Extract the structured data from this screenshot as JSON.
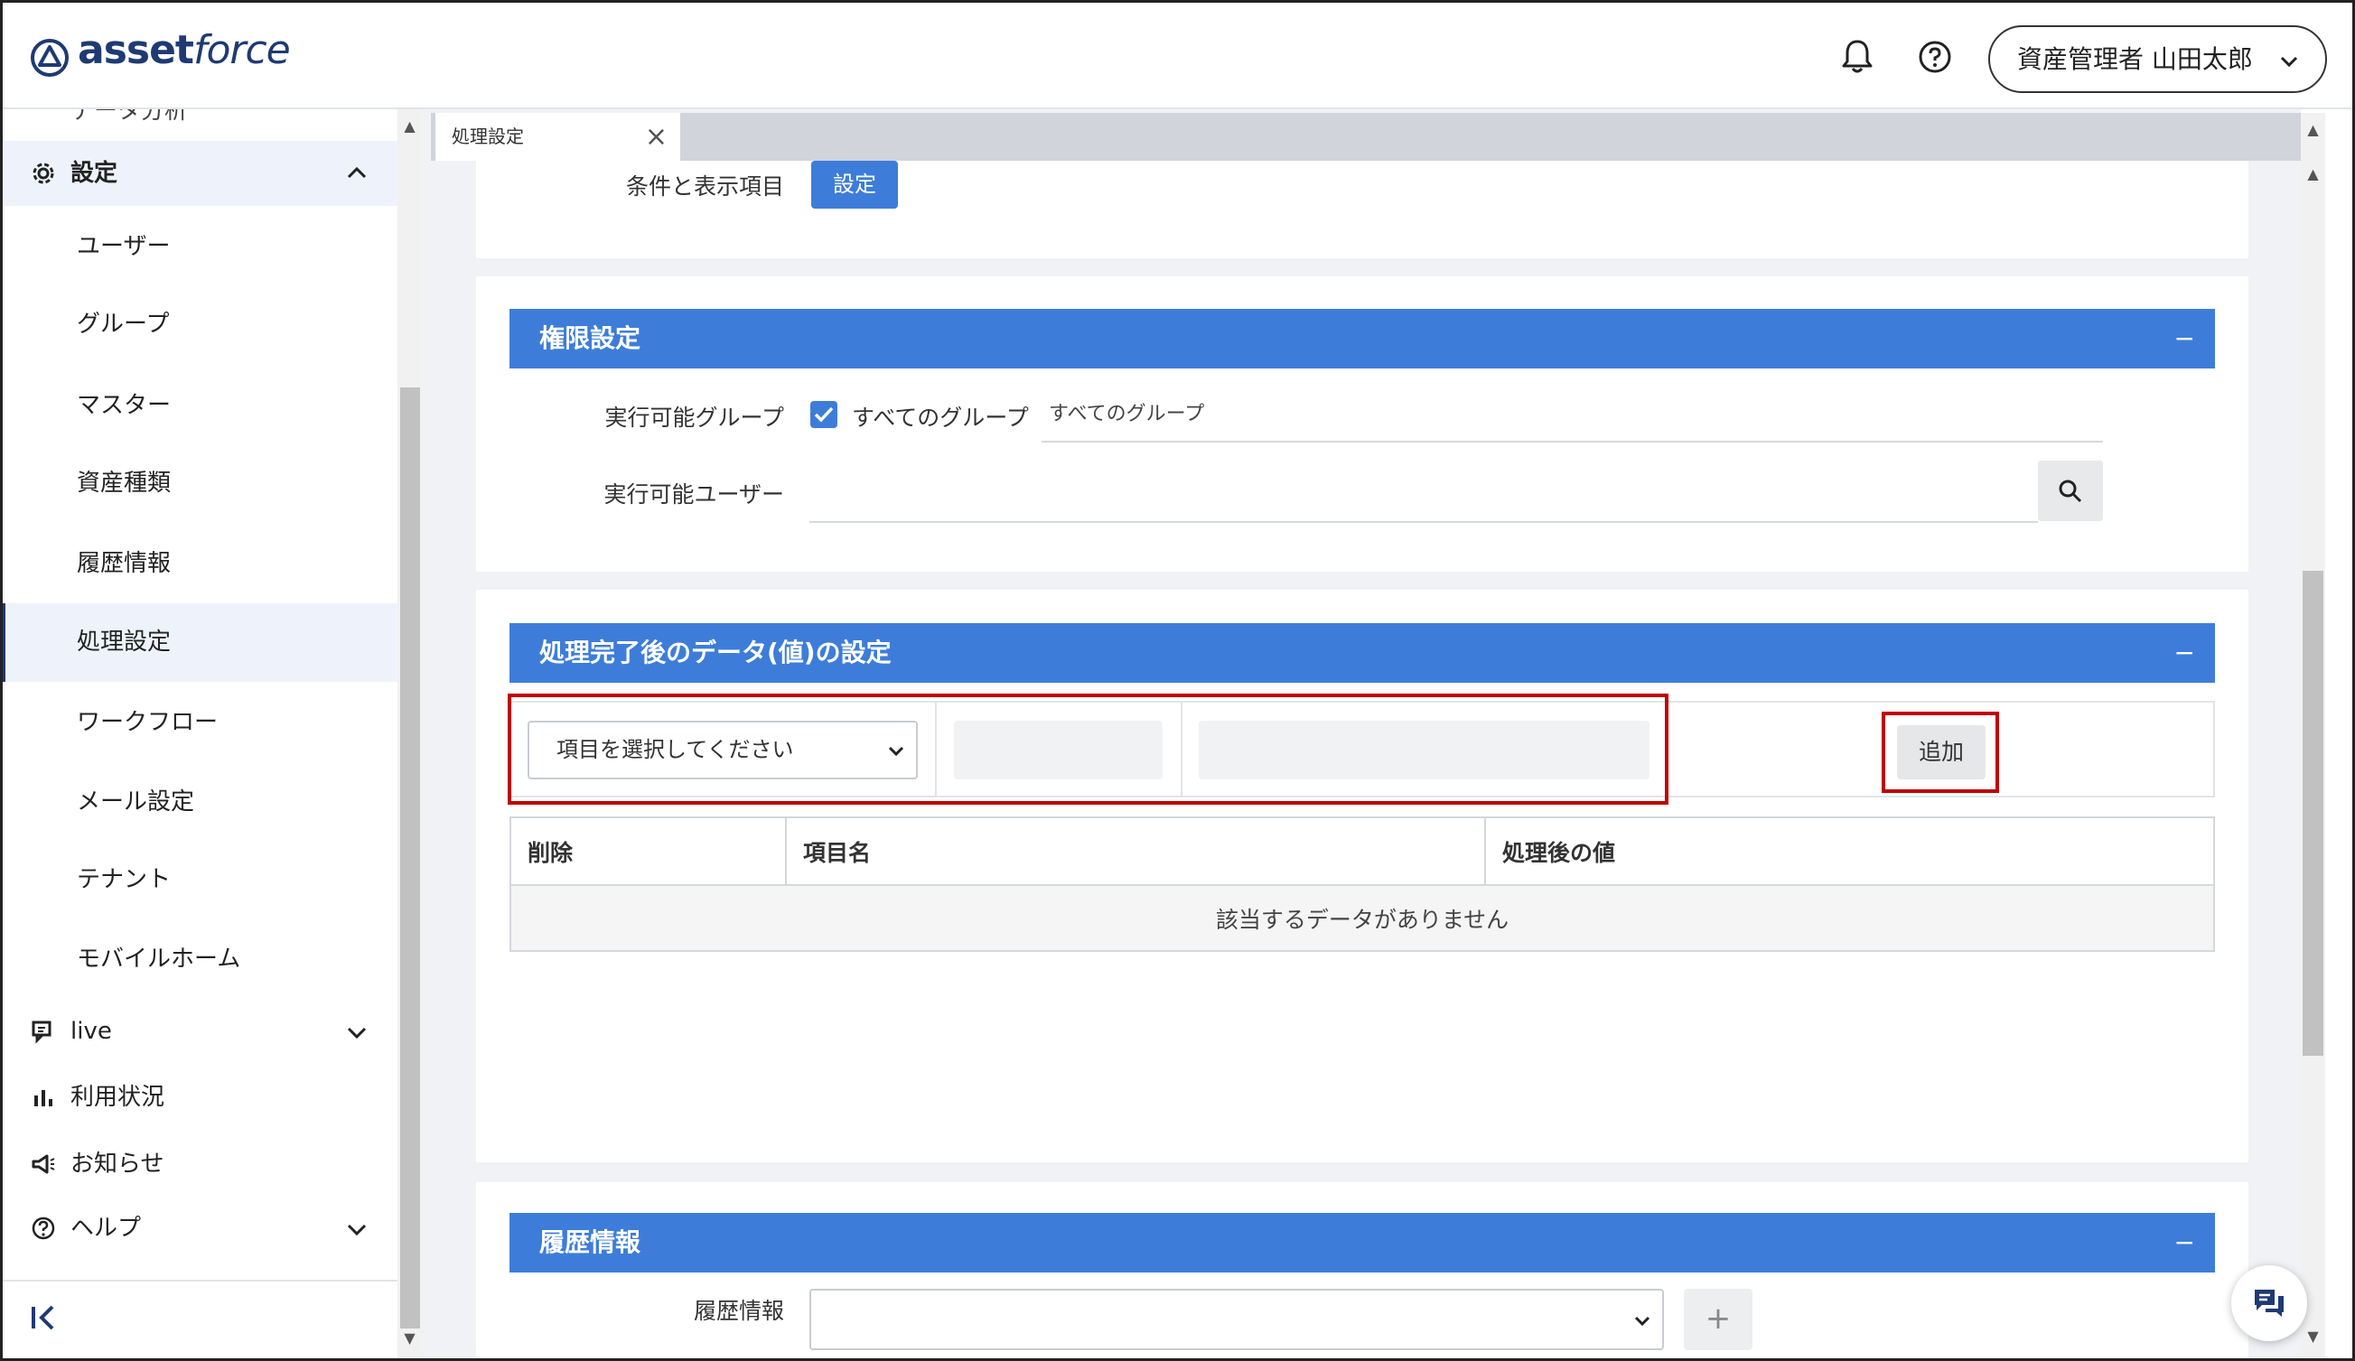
{
  "header": {
    "logo_bold": "asset",
    "logo_light": "force",
    "user_label": "資産管理者 山田太郎"
  },
  "sidebar": {
    "partial_item": "データ分析",
    "settings_label": "設定",
    "sub_items": [
      {
        "label": "ユーザー"
      },
      {
        "label": "グループ"
      },
      {
        "label": "マスター"
      },
      {
        "label": "資産種類"
      },
      {
        "label": "履歴情報"
      },
      {
        "label": "処理設定"
      },
      {
        "label": "ワークフロー"
      },
      {
        "label": "メール設定"
      },
      {
        "label": "テナント"
      },
      {
        "label": "モバイルホーム"
      }
    ],
    "live_label": "live",
    "usage_label": "利用状況",
    "news_label": "お知らせ",
    "help_label": "ヘルプ"
  },
  "tab": {
    "label": "処理設定"
  },
  "condition": {
    "label": "条件と表示項目",
    "button": "設定"
  },
  "permission": {
    "title": "権限設定",
    "group_label": "実行可能グループ",
    "all_groups_checkbox": "すべてのグループ",
    "group_value": "すべてのグループ",
    "user_label": "実行可能ユーザー",
    "user_value": ""
  },
  "post_process": {
    "title": "処理完了後のデータ(値)の設定",
    "select_placeholder": "項目を選択してください",
    "add_button": "追加",
    "columns": [
      "削除",
      "項目名",
      "処理後の値"
    ],
    "empty_message": "該当するデータがありません"
  },
  "history": {
    "title": "履歴情報",
    "label": "履歴情報",
    "add_symbol": "+"
  },
  "symbols": {
    "minus": "−",
    "close": "×"
  },
  "colors": {
    "accent": "#3d7dd9",
    "highlight": "#c00000",
    "brand": "#1f3a73"
  }
}
